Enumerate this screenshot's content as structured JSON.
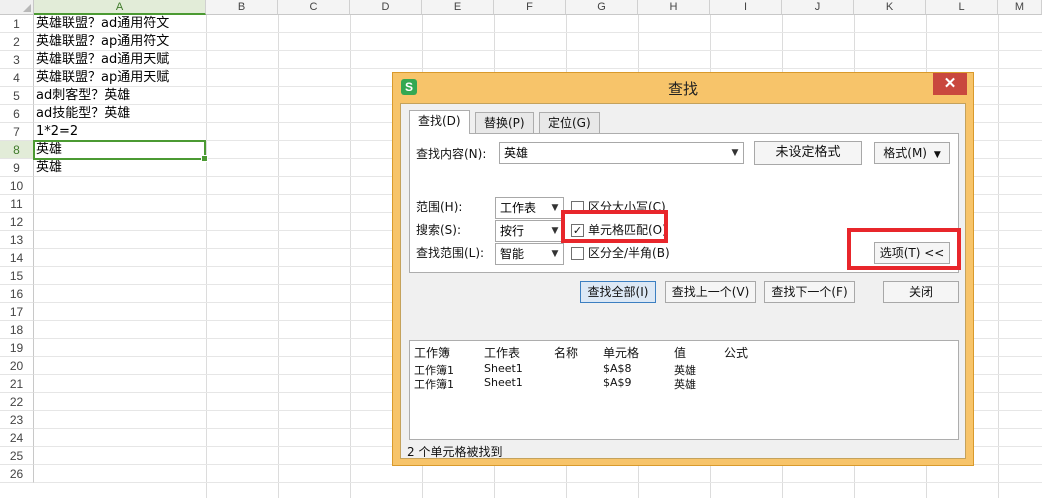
{
  "sheet": {
    "columns": [
      "A",
      "B",
      "C",
      "D",
      "E",
      "F",
      "G",
      "H",
      "I",
      "J",
      "K",
      "L",
      "M"
    ],
    "rows": [
      "1",
      "2",
      "3",
      "4",
      "5",
      "6",
      "7",
      "8",
      "9",
      "10",
      "11",
      "12",
      "13",
      "14",
      "15",
      "16",
      "17",
      "18",
      "19",
      "20",
      "21",
      "22",
      "23",
      "24",
      "25",
      "26"
    ],
    "cells": [
      "英雄联盟？ad通用符文",
      "英雄联盟？ap通用符文",
      "英雄联盟？ad通用天赋",
      "英雄联盟？ap通用天赋",
      "ad刺客型？英雄",
      "ad技能型？英雄",
      "1*2=2",
      "英雄",
      "英雄"
    ],
    "active_row": "8",
    "active_col": "A"
  },
  "dialog": {
    "title": "查找",
    "app_icon": "S",
    "close_glyph": "✕",
    "tabs": [
      "查找(D)",
      "替换(P)",
      "定位(G)"
    ],
    "find_label": "查找内容(N):",
    "find_value": "英雄",
    "no_format_button": "未设定格式",
    "format_button": "格式(M)",
    "scope_label": "范围(H):",
    "scope_value": "工作表",
    "search_label": "搜索(S):",
    "search_value": "按行",
    "lookin_label": "查找范围(L):",
    "lookin_value": "智能",
    "match_case_label": "区分大小写(C)",
    "match_cell_label": "单元格匹配(O)",
    "match_width_label": "区分全/半角(B)",
    "options_button": "选项(T) <<",
    "find_all_button": "查找全部(I)",
    "find_prev_button": "查找上一个(V)",
    "find_next_button": "查找下一个(F)",
    "close_button": "关闭",
    "results_headers": [
      "工作簿",
      "工作表",
      "名称",
      "单元格",
      "值",
      "公式"
    ],
    "results": [
      {
        "book": "工作簿1",
        "sheet": "Sheet1",
        "cell": "$A$8",
        "value": "英雄"
      },
      {
        "book": "工作簿1",
        "sheet": "Sheet1",
        "cell": "$A$9",
        "value": "英雄"
      }
    ],
    "status": "2 个单元格被找到"
  },
  "colors": {
    "accent_green": "#4b9a32",
    "dialog_frame": "#f7c46a",
    "highlight_red": "#e8262b",
    "close_red": "#c9483e"
  }
}
